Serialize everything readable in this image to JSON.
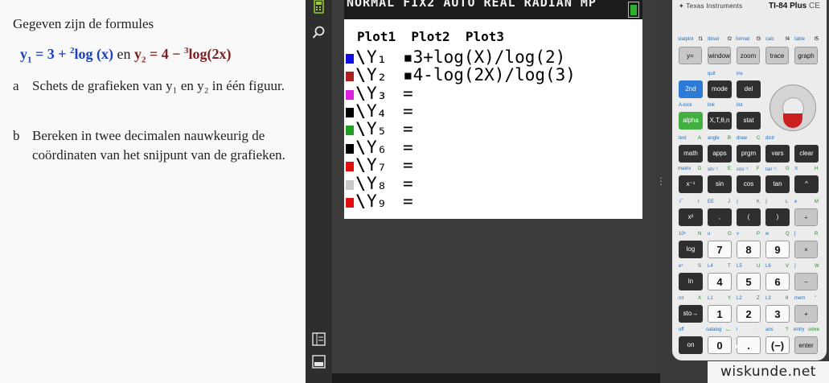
{
  "exercise": {
    "intro": "Gegeven zijn de formules",
    "formula_y1_lhs": "y",
    "formula_y1_sub": "1",
    "formula_y1_rhs_pre": " = 3 + ",
    "formula_y1_base": "2",
    "formula_y1_rhs_post": "log (x)",
    "formula_en": " en ",
    "formula_y2_lhs": "y",
    "formula_y2_sub": "2",
    "formula_y2_rhs_pre": " = 4 − ",
    "formula_y2_base": "3",
    "formula_y2_rhs_post": "log(2x)",
    "question_a_letter": "a",
    "question_a_text": "Schets de grafieken van  y₁ en y₂ in één figuur.",
    "question_b_letter": "b",
    "question_b_text": "Bereken in twee decimalen nauwkeurig de coördinaten van het snijpunt van de grafieken."
  },
  "lcd": {
    "status": "NORMAL FIX2 AUTO REAL RADIAN MP",
    "plots": "Plot1  Plot2  Plot3",
    "rows": [
      {
        "name": "Y₁",
        "eq": "3+log(X)/log(2)",
        "color": "#1010e0"
      },
      {
        "name": "Y₂",
        "eq": "4-log(2X)/log(3)",
        "color": "#b02020"
      },
      {
        "name": "Y₃",
        "eq": "",
        "color": "#e020e0"
      },
      {
        "name": "Y₄",
        "eq": "",
        "color": "#000000"
      },
      {
        "name": "Y₅",
        "eq": "",
        "color": "#20a020"
      },
      {
        "name": "Y₆",
        "eq": "",
        "color": "#000000"
      },
      {
        "name": "Y₇",
        "eq": "",
        "color": "#e01010"
      },
      {
        "name": "Y₈",
        "eq": "",
        "color": "#c8c8c8"
      },
      {
        "name": "Y₉",
        "eq": "",
        "color": "#e01010"
      }
    ]
  },
  "calculator": {
    "brand": "Texas Instruments",
    "model": "TI-84 Plus",
    "model_suffix": "CE",
    "keys": {
      "y_eq": "y=",
      "window": "window",
      "zoom": "zoom",
      "trace": "trace",
      "graph": "graph",
      "second": "2nd",
      "mode": "mode",
      "del": "del",
      "alpha": "alpha",
      "xton": "X,T,θ,n",
      "stat": "stat",
      "math": "math",
      "apps": "apps",
      "prgm": "prgm",
      "vars": "vars",
      "clear": "clear",
      "xinv": "x⁻¹",
      "sin": "sin",
      "cos": "cos",
      "tan": "tan",
      "pow": "^",
      "xsq": "x²",
      "comma": ",",
      "lparen": "(",
      "rparen": ")",
      "div": "÷",
      "log": "log",
      "k7": "7",
      "k8": "8",
      "k9": "9",
      "mul": "×",
      "ln": "ln",
      "k4": "4",
      "k5": "5",
      "k6": "6",
      "minus": "−",
      "sto": "sto→",
      "k1": "1",
      "k2": "2",
      "k3": "3",
      "plus": "+",
      "on": "on",
      "k0": "0",
      "dot": ".",
      "neg": "(−)",
      "enter": "enter"
    },
    "labels": {
      "r1": [
        "statplot",
        "f1",
        "tblset",
        "f2",
        "format",
        "f3",
        "calc",
        "f4",
        "table",
        "f5"
      ],
      "quit": "quit",
      "ins": "ins",
      "alock": "A-lock",
      "link": "link",
      "list": "list",
      "test": "test",
      "A": "A",
      "angle": "angle",
      "B": "B",
      "draw": "draw",
      "C": "C",
      "distr": "distr",
      "matrix": "matrix",
      "D": "D",
      "sininv": "sin⁻¹",
      "E": "E",
      "cosinv": "cos⁻¹",
      "F": "F",
      "taninv": "tan⁻¹",
      "G": "G",
      "pi": "π",
      "H": "H",
      "sqrt": "√‾",
      "I": "I",
      "EE": "EE",
      "J": "J",
      "lbrace": "{",
      "K": "K",
      "rbrace": "}",
      "L": "L",
      "e": "e",
      "M": "M",
      "tenx": "10ˣ",
      "N": "N",
      "u": "u",
      "O": "O",
      "v": "v",
      "P": "P",
      "w": "w",
      "Q": "Q",
      "lbrack": "[",
      "R": "R",
      "ex": "eˣ",
      "S": "S",
      "L4": "L4",
      "T": "T",
      "L5": "L5",
      "U": "U",
      "L6": "L6",
      "V": "V",
      "rbrack": "]",
      "W": "W",
      "rcl": "rcl",
      "X": "X",
      "L1": "L1",
      "Y": "Y",
      "L2": "L2",
      "Z": "Z",
      "L3": "L3",
      "theta": "θ",
      "mem": "mem",
      "quote": "\"",
      "off": "off",
      "catalog": "catalog",
      "space": "⌴",
      "i": "i",
      "colon": ":",
      "ans": "ans",
      "q": "?",
      "entry": "entry",
      "solve": "solve"
    }
  },
  "watermark": "wiskunde.net"
}
